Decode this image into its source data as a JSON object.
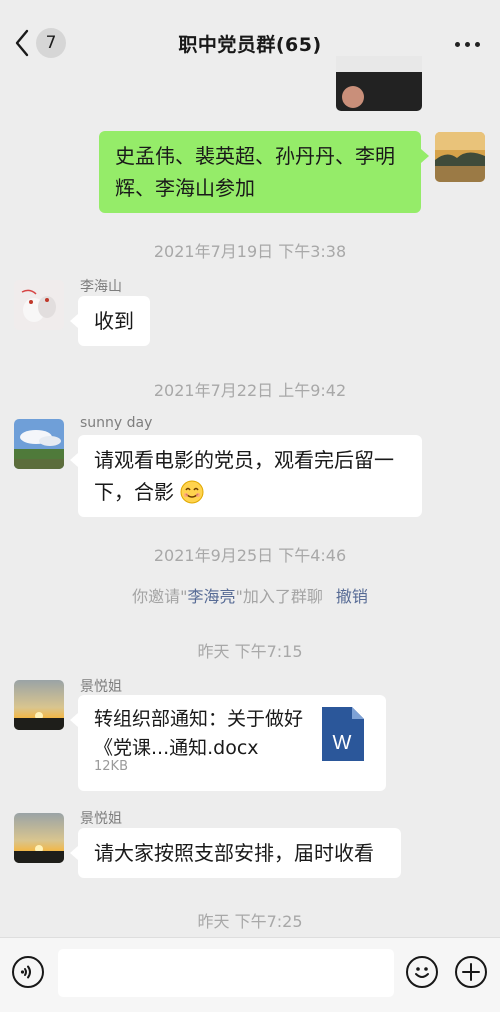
{
  "header": {
    "back_count": "7",
    "title": "职中党员群(65)"
  },
  "messages": {
    "m1": {
      "text": "史孟伟、裴英超、孙丹丹、李明辉、李海山参加"
    },
    "t1": "2021年7月19日 下午3:38",
    "m2": {
      "sender": "李海山",
      "text": "收到"
    },
    "t2": "2021年7月22日 上午9:42",
    "m3": {
      "sender": "sunny day",
      "text": "请观看电影的党员，观看完后留一下，合影"
    },
    "t3": "2021年9月25日 下午4:46",
    "sys1": {
      "prefix": "你邀请\"",
      "name": "李海亮",
      "suffix": "\"加入了群聊",
      "action": "撤销"
    },
    "t4": "昨天 下午7:15",
    "m4": {
      "sender": "景悦姐",
      "file_name": "转组织部通知：关于做好《党课...通知.docx",
      "file_size": "12KB",
      "file_icon_letter": "W"
    },
    "m5": {
      "sender": "景悦姐",
      "text": "请大家按照支部安排，届时收看"
    },
    "t5": "昨天 下午7:25"
  },
  "colors": {
    "accent_green": "#95ec69",
    "link_blue": "#576b95",
    "word_blue": "#2b579a"
  },
  "icons": [
    "back-chevron-icon",
    "more-icon",
    "voice-icon",
    "emoji-icon",
    "add-icon",
    "word-file-icon",
    "smile-emoji-icon"
  ]
}
